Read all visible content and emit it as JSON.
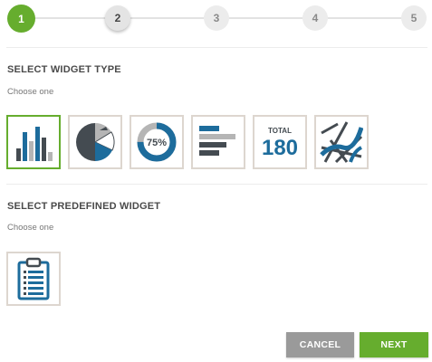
{
  "stepper": {
    "steps": [
      "1",
      "2",
      "3",
      "4",
      "5"
    ],
    "colors": {
      "active": "#66ad2e",
      "inactive": "#ececec"
    }
  },
  "widget_type": {
    "title": "SELECT WIDGET TYPE",
    "subtitle": "Choose one",
    "options": [
      {
        "icon": "bar-chart-icon",
        "selected": true
      },
      {
        "icon": "pie-chart-icon",
        "selected": false
      },
      {
        "icon": "donut-gauge-icon",
        "selected": false,
        "label": "75%"
      },
      {
        "icon": "horizontal-bar-icon",
        "selected": false
      },
      {
        "icon": "total-number-icon",
        "selected": false,
        "caption": "TOTAL",
        "value": "180"
      },
      {
        "icon": "map-icon",
        "selected": false
      }
    ]
  },
  "predefined": {
    "title": "SELECT PREDEFINED WIDGET",
    "subtitle": "Choose one",
    "options": [
      {
        "icon": "clipboard-icon"
      }
    ]
  },
  "actions": {
    "cancel_label": "CANCEL",
    "next_label": "NEXT"
  },
  "colors": {
    "accent": "#66ad2e",
    "blue": "#1d6c9c",
    "dark": "#444b51",
    "gray": "#b5b5b5"
  }
}
